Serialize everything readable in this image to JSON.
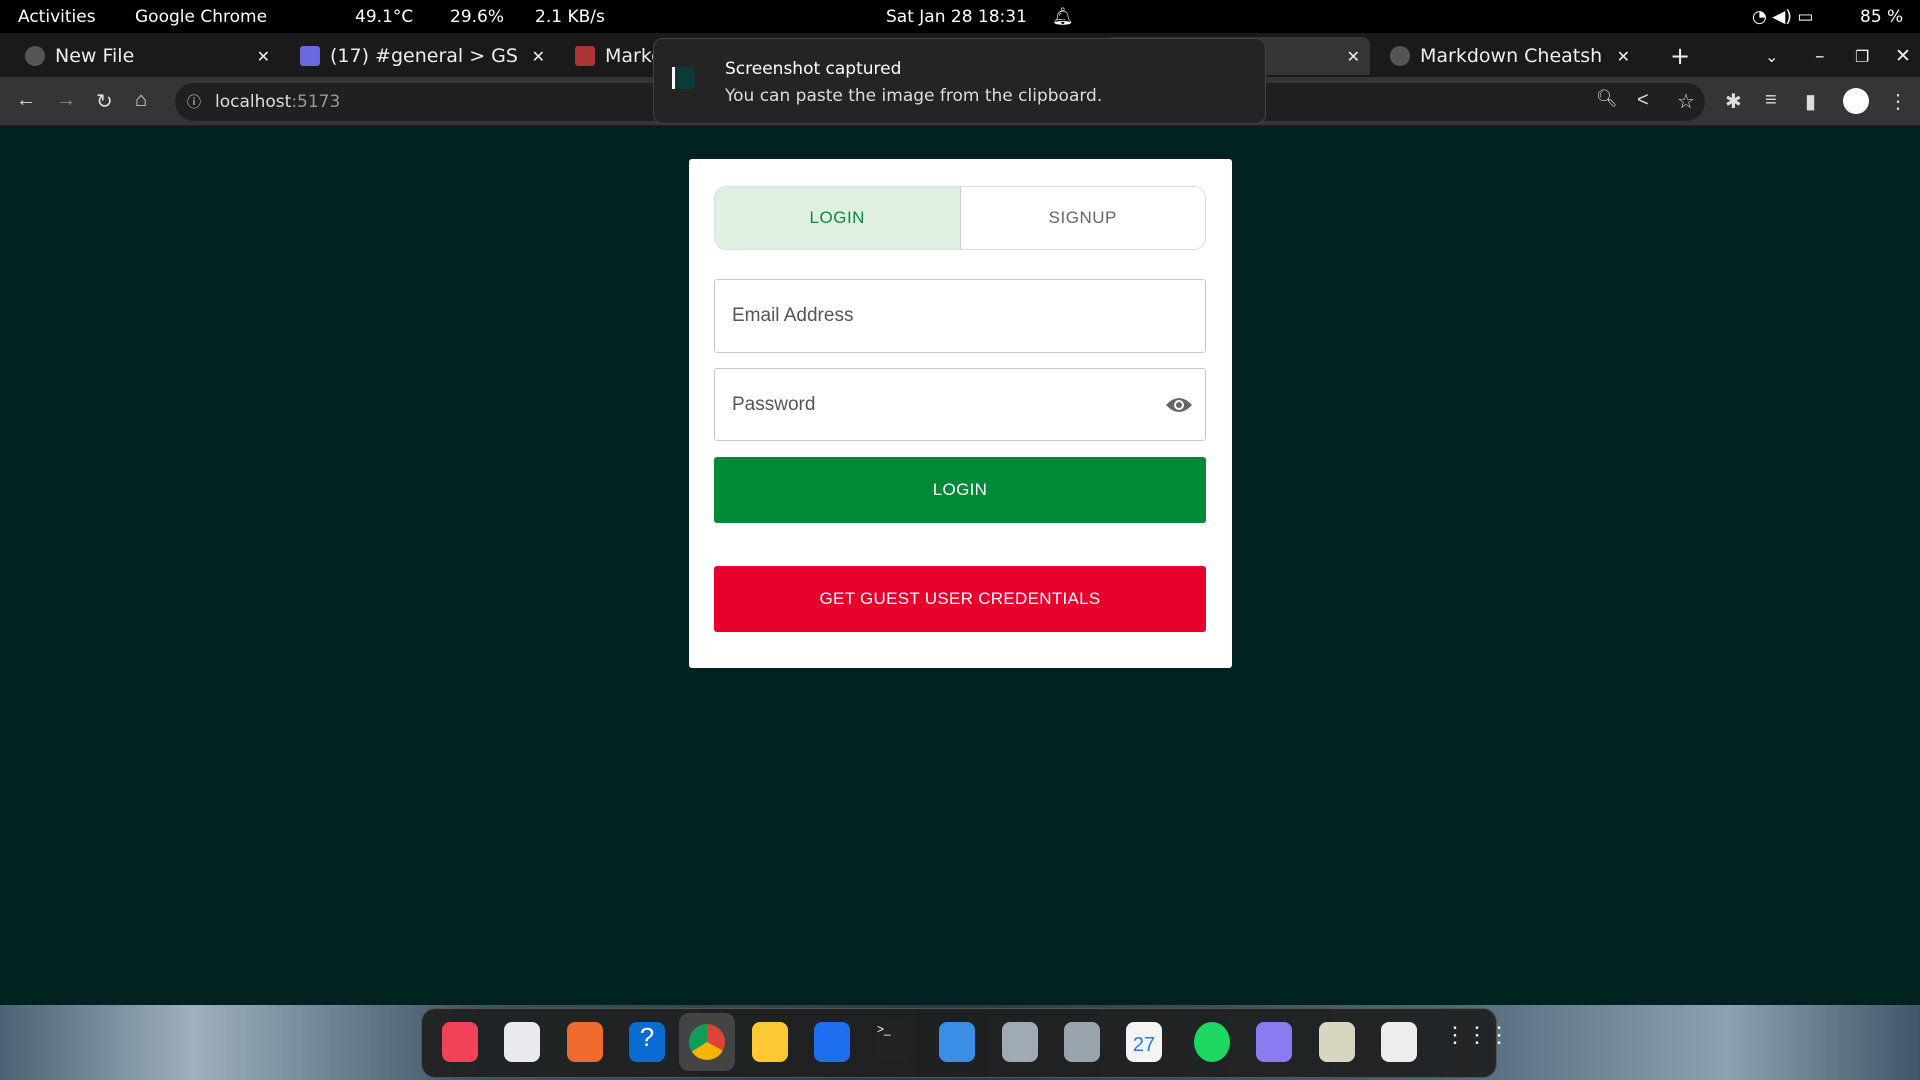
{
  "topbar": {
    "activities": "Activities",
    "app": "Google Chrome",
    "temp": "49.1°C",
    "cpu": "29.6%",
    "net": "2.1 KB/s",
    "datetime": "Sat Jan 28  18:31",
    "battery": "85 %"
  },
  "tabs": [
    {
      "title": "New File"
    },
    {
      "title": "(17) #general > GS"
    },
    {
      "title": "Marko"
    },
    {
      "title": "Markdown Cheatsh"
    }
  ],
  "address": {
    "url_host": "localhost",
    "url_port": ":5173"
  },
  "toast": {
    "title": "Screenshot captured",
    "message": "You can paste the image from the clipboard."
  },
  "form": {
    "tab_login": "LOGIN",
    "tab_signup": "SIGNUP",
    "email_placeholder": "Email Address",
    "password_placeholder": "Password",
    "login_button": "LOGIN",
    "guest_button": "GET GUEST USER CREDENTIALS"
  },
  "colors": {
    "primary": "#008a37",
    "danger": "#e8002d",
    "background": "#012220"
  },
  "dock": {
    "apps": [
      "music",
      "libreoffice-writer",
      "app-center",
      "help",
      "chrome",
      "files",
      "vscode",
      "terminal",
      "extensions",
      "toggle",
      "settings",
      "calendar",
      "spotify",
      "camera",
      "text-editor",
      "trash",
      "app-grid"
    ],
    "calendar_day": "27"
  }
}
